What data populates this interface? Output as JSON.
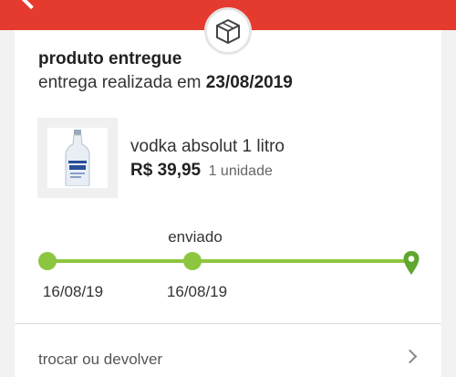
{
  "header": {
    "back_icon": "chevron-left-icon",
    "color": "#e53b2e"
  },
  "order": {
    "badge_icon": "box-icon",
    "status": "produto entregue",
    "delivery_prefix": "entrega realizada em",
    "delivery_date": "23/08/2019"
  },
  "product": {
    "image_icon": "vodka-bottle-image",
    "name": "vodka absolut 1 litro",
    "price": "R$ 39,95",
    "quantity": "1 unidade"
  },
  "tracking": {
    "accent": "#8cc63f",
    "steps": [
      {
        "label": "",
        "date": "16/08/19"
      },
      {
        "label": "enviado",
        "date": "16/08/19"
      },
      {
        "label": "",
        "date": "",
        "icon": "location-pin-icon"
      }
    ]
  },
  "actions": {
    "exchange_label": "trocar ou devolver",
    "exchange_icon": "chevron-right-icon"
  }
}
